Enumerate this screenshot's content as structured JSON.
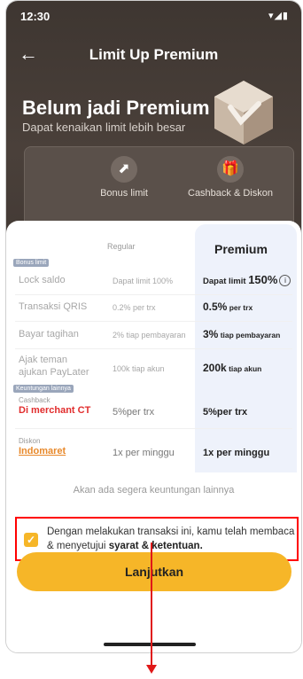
{
  "status": {
    "time": "12:30",
    "icons": "▾◢▮"
  },
  "topbar": {
    "back_icon": "←",
    "title": "Limit Up Premium"
  },
  "hero": {
    "title": "Belum jadi Premium",
    "subtitle": "Dapat kenaikan limit lebih besar"
  },
  "benefits": [
    {
      "label": "Bonus limit",
      "icon": "rocket-icon",
      "glyph": "⬈"
    },
    {
      "label": "Cashback & Diskon",
      "icon": "gift-icon",
      "glyph": "🎁"
    }
  ],
  "table": {
    "headers": {
      "regular": "Regular",
      "premium": "Premium"
    },
    "section_bonus": "Bonus limit",
    "section_other": "Keuntungan lainnya",
    "rows": [
      {
        "label": "Lock saldo",
        "regular": "Dapat limit 100%",
        "premium_main": "Dapat limit ",
        "premium_big": "150%"
      },
      {
        "label": "Transaksi QRIS",
        "regular": "0.2% per trx",
        "premium_main": "0.5%",
        "premium_small": " per trx"
      },
      {
        "label": "Bayar tagihan",
        "regular": "2% tiap pembayaran",
        "premium_main": "3%",
        "premium_small": " tiap pembayaran"
      },
      {
        "label": "Ajak teman ajukan PayLater",
        "regular": "100k tiap akun",
        "premium_main": "200k",
        "premium_small": " tiap akun"
      }
    ],
    "cashback": {
      "small": "Cashback",
      "main": "Di merchant CT",
      "regular": "5%per trx",
      "premium": "5%per trx"
    },
    "diskon": {
      "small": "Diskon",
      "main": "Indomaret",
      "regular": "1x per minggu",
      "premium": "1x per minggu"
    }
  },
  "more_text": "Akan ada segera keuntungan lainnya",
  "consent": {
    "text": "Dengan melakukan transaksi ini, kamu telah membaca & menyetujui ",
    "link": "syarat & ketentuan.",
    "checked": true
  },
  "cta": {
    "label": "Lanjutkan"
  },
  "colors": {
    "accent": "#f6b628",
    "hero_bg": "#433a35",
    "highlight": "#ff0000"
  }
}
